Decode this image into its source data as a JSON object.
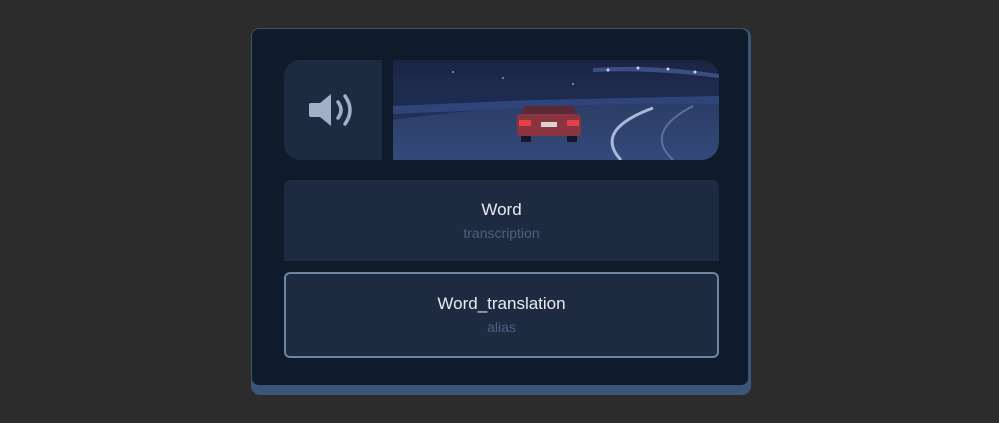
{
  "card": {
    "word": "Word",
    "transcription": "transcription",
    "translation": "Word_translation",
    "alias": "alias"
  },
  "icons": {
    "audio": "speaker-icon"
  },
  "colors": {
    "page_background": "#2c2c2c",
    "card_background": "#0f1a2b",
    "panel_background": "#1e2a40",
    "card_accent": "#3c5678",
    "selected_border": "#6d84a5",
    "primary_text": "#e8ebf0",
    "secondary_text": "#4a6081"
  }
}
